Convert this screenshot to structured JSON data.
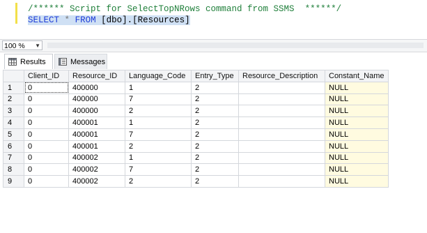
{
  "editor": {
    "comment": "/****** Script for SelectTopNRows command from SSMS  ******/",
    "query": {
      "select": "SELECT",
      "star": "*",
      "from": "FROM",
      "table": "[dbo].[Resources]"
    }
  },
  "zoom": {
    "value": "100 %"
  },
  "tabs": {
    "results": "Results",
    "messages": "Messages"
  },
  "grid": {
    "columns": [
      "",
      "Client_ID",
      "Resource_ID",
      "Language_Code",
      "Entry_Type",
      "Resource_Description",
      "Constant_Name"
    ],
    "rows": [
      [
        "1",
        "0",
        "400000",
        "1",
        "2",
        "",
        "NULL"
      ],
      [
        "2",
        "0",
        "400000",
        "7",
        "2",
        "",
        "NULL"
      ],
      [
        "3",
        "0",
        "400000",
        "2",
        "2",
        "",
        "NULL"
      ],
      [
        "4",
        "0",
        "400001",
        "1",
        "2",
        "",
        "NULL"
      ],
      [
        "5",
        "0",
        "400001",
        "7",
        "2",
        "",
        "NULL"
      ],
      [
        "6",
        "0",
        "400001",
        "2",
        "2",
        "",
        "NULL"
      ],
      [
        "7",
        "0",
        "400002",
        "1",
        "2",
        "",
        "NULL"
      ],
      [
        "8",
        "0",
        "400002",
        "7",
        "2",
        "",
        "NULL"
      ],
      [
        "9",
        "0",
        "400002",
        "2",
        "2",
        "",
        "NULL"
      ]
    ]
  },
  "colors": {
    "keyword": "#1e3cd8",
    "comment": "#1f7f3a",
    "selection": "#cfe0f4",
    "null_cell": "#fffbe0"
  },
  "icons": {
    "results_tab": "grid-icon",
    "messages_tab": "messages-icon",
    "zoom_dropdown": "chevron-down-icon"
  }
}
